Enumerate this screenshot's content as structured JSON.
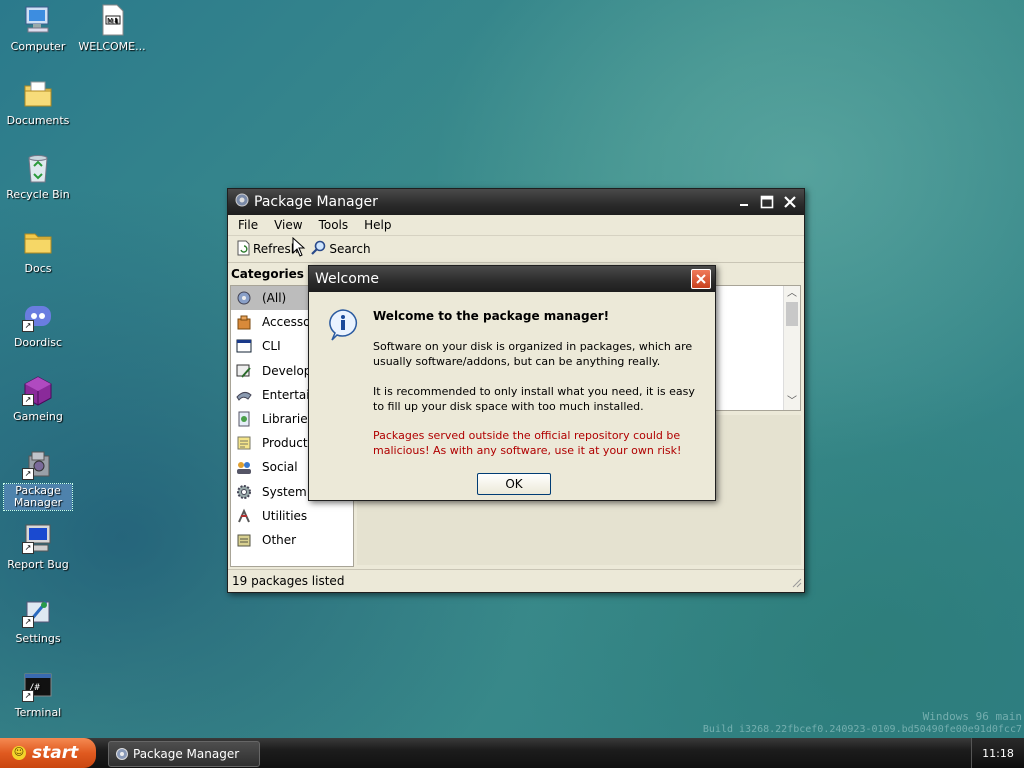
{
  "desktop": {
    "icons": [
      {
        "label": "Computer"
      },
      {
        "label": "WELCOME...",
        "badge": "M⬇"
      },
      {
        "label": "Documents"
      },
      {
        "label": "Recycle Bin"
      },
      {
        "label": "Docs"
      },
      {
        "label": "Doordisc"
      },
      {
        "label": "Gameing"
      },
      {
        "label": "Package Manager"
      },
      {
        "label": "Report Bug"
      },
      {
        "label": "Settings"
      },
      {
        "label": "Terminal",
        "badge": "/#"
      }
    ],
    "watermark_line1": "Windows 96 main",
    "watermark_line2": "Build i3268.22fbcef0.240923-0109.bd50490fe00e91d0fcc7"
  },
  "package_manager": {
    "title": "Package Manager",
    "menu": [
      "File",
      "View",
      "Tools",
      "Help"
    ],
    "toolbar": {
      "refresh": "Refresh",
      "search": "Search"
    },
    "categories_header": "Categories",
    "categories": [
      "(All)",
      "Accessories",
      "CLI",
      "Development",
      "Entertainment",
      "Libraries",
      "Productivity",
      "Social",
      "System",
      "Utilities",
      "Other"
    ],
    "status": "19 packages listed"
  },
  "dialog": {
    "title": "Welcome",
    "heading": "Welcome to the package manager!",
    "para1": "Software on your disk is organized in packages, which are usually software/addons, but can be anything really.",
    "para2": "It is recommended to only install what you need, it is easy to fill up your disk space with too much installed.",
    "warning": "Packages served outside the official repository could be malicious! As with any software, use it at your own risk!",
    "ok": "OK"
  },
  "taskbar": {
    "start": "start",
    "task": "Package Manager",
    "clock": "11:18"
  },
  "colors": {
    "warning": "#b00000",
    "titlebar": "#2b2b2b",
    "start": "#e05a20"
  }
}
